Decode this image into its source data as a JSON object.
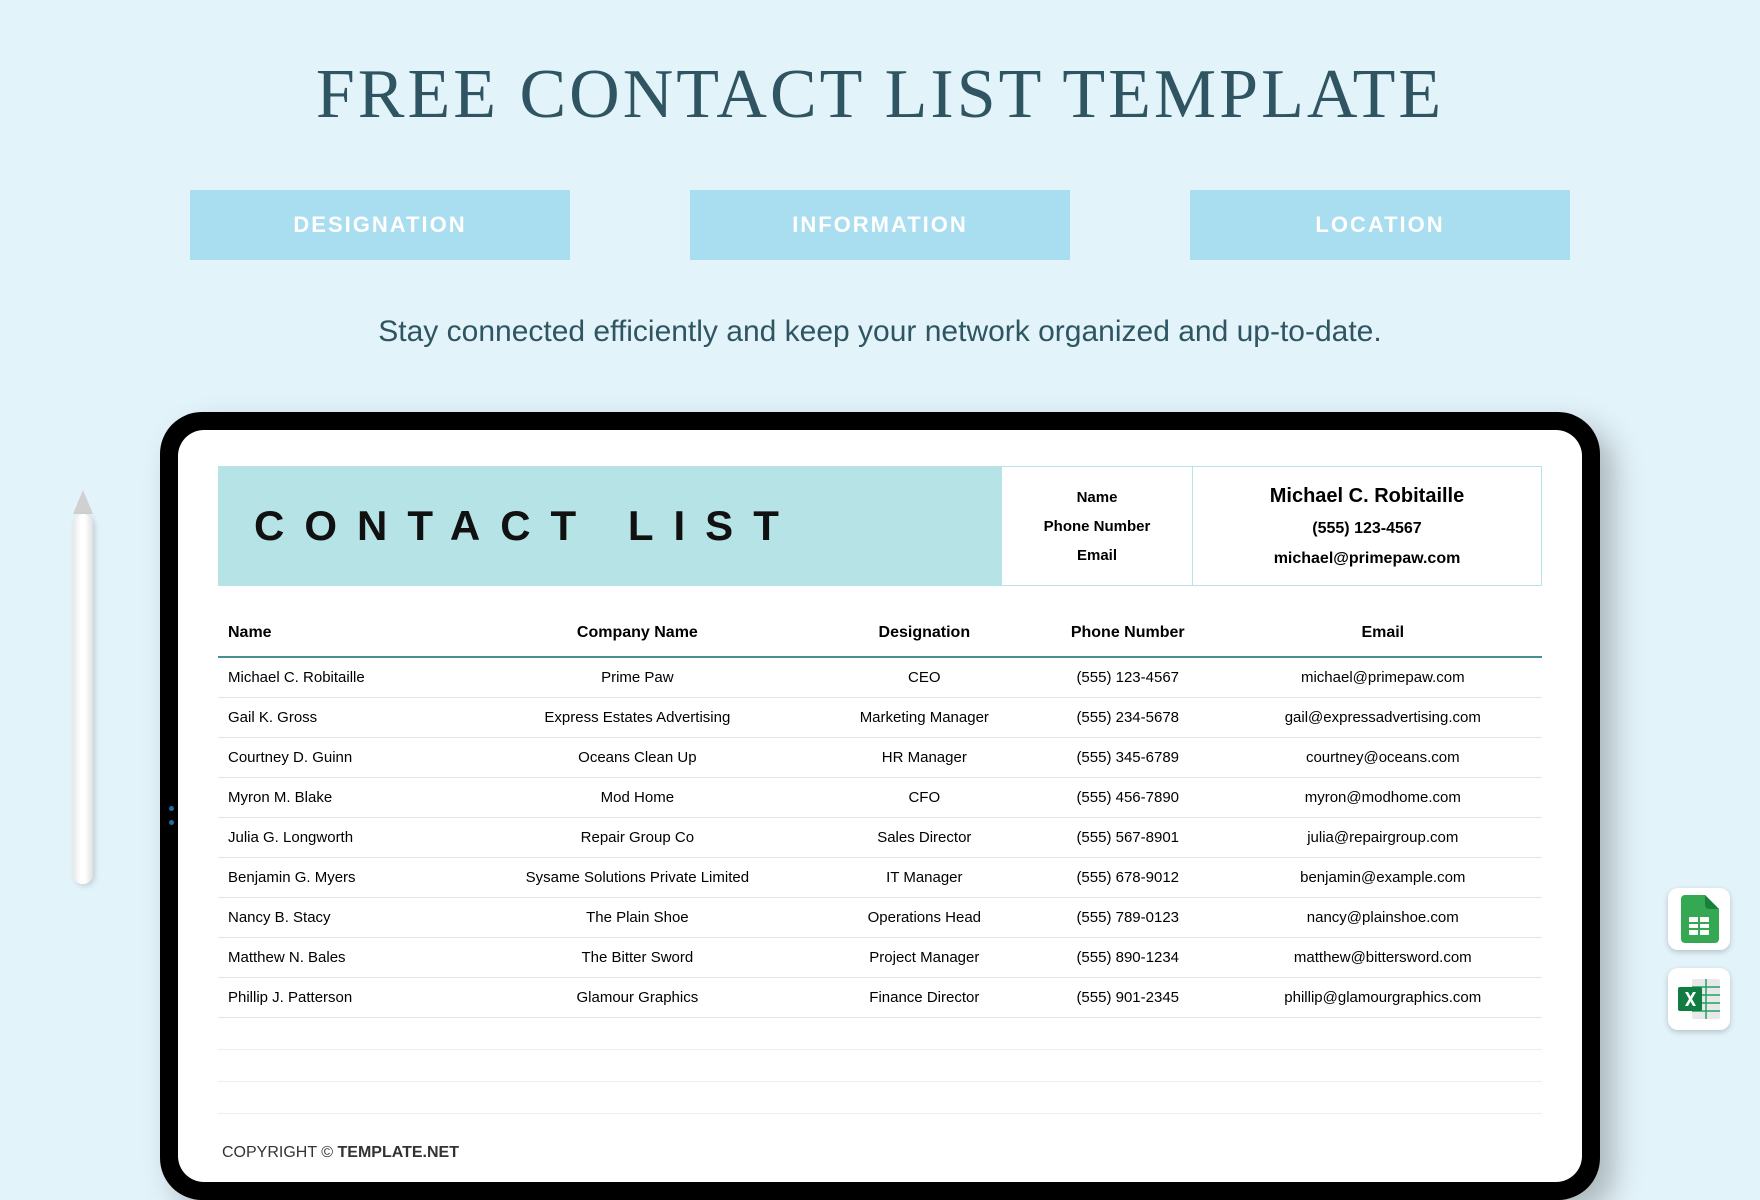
{
  "page": {
    "title": "FREE CONTACT LIST TEMPLATE",
    "subtitle": "Stay connected efficiently and keep your network organized and up-to-date.",
    "copyright_prefix": "COPYRIGHT © ",
    "copyright_brand": "TEMPLATE.NET"
  },
  "pills": [
    "DESIGNATION",
    "INFORMATION",
    "LOCATION"
  ],
  "document": {
    "title": "CONTACT LIST",
    "info_labels": {
      "name": "Name",
      "phone": "Phone Number",
      "email": "Email"
    },
    "info_values": {
      "name": "Michael C. Robitaille",
      "phone": "(555) 123-4567",
      "email": "michael@primepaw.com"
    },
    "columns": [
      "Name",
      "Company Name",
      "Designation",
      "Phone Number",
      "Email"
    ],
    "rows": [
      {
        "name": "Michael C. Robitaille",
        "company": "Prime Paw",
        "designation": "CEO",
        "phone": "(555) 123-4567",
        "email": "michael@primepaw.com"
      },
      {
        "name": "Gail K. Gross",
        "company": "Express Estates Advertising",
        "designation": "Marketing Manager",
        "phone": "(555) 234-5678",
        "email": "gail@expressadvertising.com"
      },
      {
        "name": "Courtney D. Guinn",
        "company": "Oceans Clean Up",
        "designation": "HR Manager",
        "phone": "(555) 345-6789",
        "email": "courtney@oceans.com"
      },
      {
        "name": "Myron M. Blake",
        "company": "Mod Home",
        "designation": "CFO",
        "phone": "(555) 456-7890",
        "email": "myron@modhome.com"
      },
      {
        "name": "Julia G. Longworth",
        "company": "Repair Group Co",
        "designation": "Sales Director",
        "phone": "(555) 567-8901",
        "email": "julia@repairgroup.com"
      },
      {
        "name": "Benjamin G. Myers",
        "company": "Sysame Solutions Private Limited",
        "designation": "IT Manager",
        "phone": "(555) 678-9012",
        "email": "benjamin@example.com"
      },
      {
        "name": "Nancy B. Stacy",
        "company": "The Plain Shoe",
        "designation": "Operations Head",
        "phone": "(555) 789-0123",
        "email": "nancy@plainshoe.com"
      },
      {
        "name": "Matthew N. Bales",
        "company": "The Bitter Sword",
        "designation": "Project Manager",
        "phone": "(555) 890-1234",
        "email": "matthew@bittersword.com"
      },
      {
        "name": "Phillip J. Patterson",
        "company": "Glamour Graphics",
        "designation": "Finance Director",
        "phone": "(555) 901-2345",
        "email": "phillip@glamourgraphics.com"
      }
    ]
  }
}
